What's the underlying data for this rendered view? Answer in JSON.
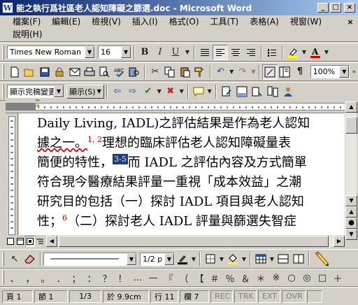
{
  "window": {
    "title": "能之執行爲社區老人認知障礙之篩選.doc - Microsoft Word",
    "app_icon_label": "W"
  },
  "window_controls": {
    "minimize": "_",
    "maximize": "□",
    "close": "×"
  },
  "menu": [
    {
      "label": "檔案(F)"
    },
    {
      "label": "編輯(E)"
    },
    {
      "label": "檢視(V)"
    },
    {
      "label": "插入(I)"
    },
    {
      "label": "格式(O)"
    },
    {
      "label": "工具(T)"
    },
    {
      "label": "表格(A)"
    },
    {
      "label": "視窗(W)"
    },
    {
      "label": "說明(H)"
    }
  ],
  "doc_close": "×",
  "format_toolbar": {
    "font_name": "Times New Roman",
    "font_size": "16",
    "bold": "B",
    "italic": "I",
    "underline": "U",
    "font_color": "#d00000",
    "highlight_color": "#ffff00"
  },
  "standard_toolbar": {
    "zoom": "100%"
  },
  "reviewing_toolbar": {
    "display_mode": "顯示完稿變更",
    "display_menu": "顯示(S)"
  },
  "document": {
    "lines": [
      {
        "text": "Daily Living, IADL)之評估結果是作為老人認知"
      },
      {
        "pre": "據之一。",
        "sup": "1, 2",
        "post": "理想的臨床評估老人認知障礙量表"
      },
      {
        "pre": "簡便的特性，",
        "sup_selected": "3-5",
        "post": "而 IADL 之評估內容及方式簡單"
      },
      {
        "text": "符合現今醫療結果評量一重視「成本效益」之潮"
      },
      {
        "text": "研究目的包括（一）探討 IADL 項目與老人認知"
      },
      {
        "pre": "性；",
        "sup": "6",
        "post": "（二）探討老人 IADL 評量與篩選失智症"
      }
    ]
  },
  "drawing_toolbar": {
    "line_weight": "1/2 p"
  },
  "status_bar": {
    "page": "頁 1",
    "section": "節 1",
    "page_of": "1/3",
    "at": "於 9.9cm",
    "line": "行 11",
    "col": "欄 7",
    "rec": "REC",
    "trk": "TRK",
    "ext": "EXT",
    "ovr": "OVR"
  }
}
